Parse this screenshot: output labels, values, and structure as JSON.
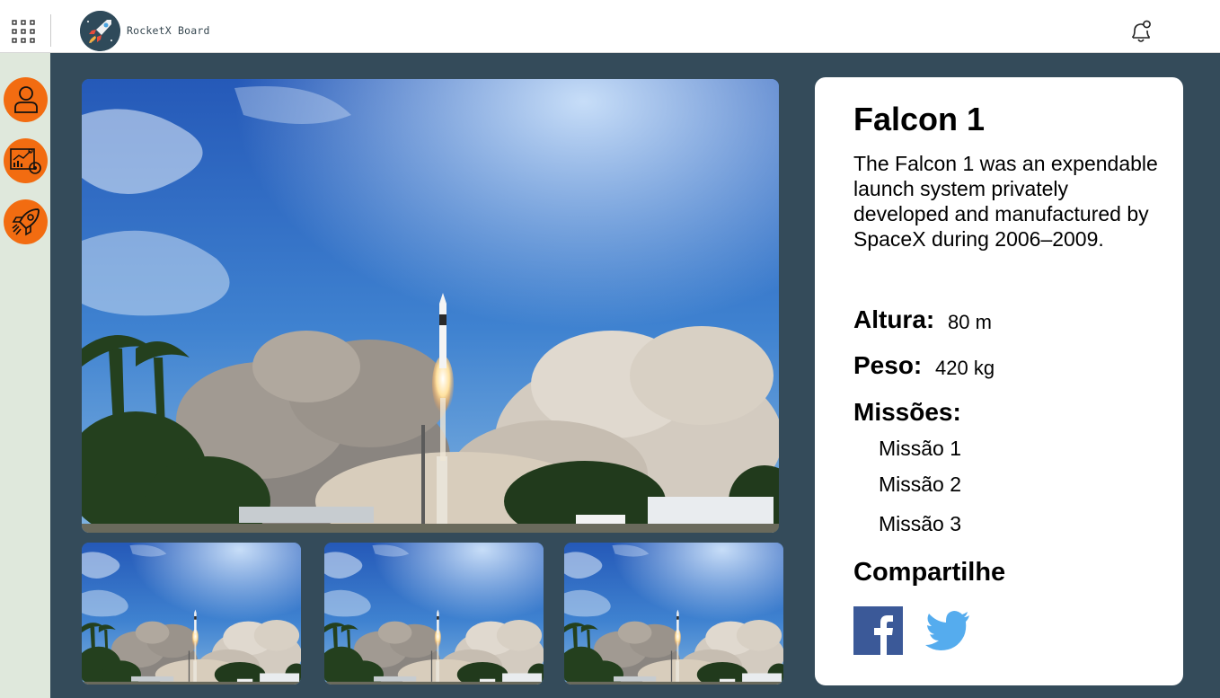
{
  "header": {
    "brand": "RocketX Board",
    "icons": {
      "apps": "apps-grid-icon",
      "notifications": "bell-icon"
    }
  },
  "sidebar": {
    "items": [
      {
        "name": "user",
        "icon": "user-icon"
      },
      {
        "name": "dashboard",
        "icon": "analytics-report-icon"
      },
      {
        "name": "rockets",
        "icon": "rocket-icon"
      }
    ]
  },
  "gallery": {
    "main_image": "rocket-launch-photo",
    "thumbnails": [
      "rocket-launch-photo",
      "rocket-launch-photo",
      "rocket-launch-photo"
    ]
  },
  "rocket": {
    "name": "Falcon 1",
    "description": "The Falcon 1 was an expendable launch system privately developed and manufactured by SpaceX during 2006–2009.",
    "height_label": "Altura:",
    "height_value": "80 m",
    "weight_label": "Peso:",
    "weight_value": "420 kg",
    "missions_label": "Missões:",
    "missions": [
      "Missão 1",
      "Missão 2",
      "Missão 3"
    ]
  },
  "share": {
    "label": "Compartilhe",
    "networks": [
      "facebook-icon",
      "twitter-icon"
    ]
  },
  "colors": {
    "sidebar_bg": "#dfe8dc",
    "main_bg": "#344b5a",
    "accent_orange": "#f26c11",
    "facebook": "#3b5998",
    "twitter": "#55acee"
  }
}
